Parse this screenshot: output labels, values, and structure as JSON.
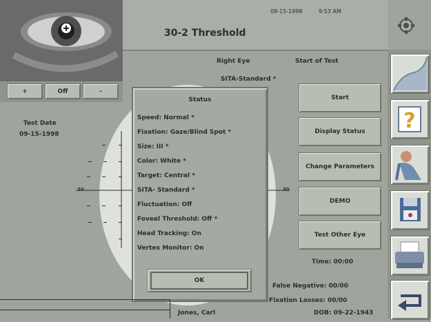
{
  "header": {
    "title": "30-2 Threshold",
    "date": "09-15-1998",
    "time": "9:53 AM"
  },
  "eye_camera": {
    "buttons": [
      "+",
      "Off",
      "-"
    ]
  },
  "test_info": {
    "eye": "Right Eye",
    "state": "Start of Test",
    "strategy": "SITA-Standard  *",
    "date_label": "Test Date",
    "date_value": "09-15-1998"
  },
  "status_dialog": {
    "title": "Status",
    "lines": [
      "Speed: Normal  *",
      "Fixation: Gaze/Blind Spot *",
      "Size: III  *",
      "Color: White  *",
      "Target: Central  *",
      "SITA- Standard  *",
      "Fluctuation: Off",
      "Foveal Threshold: Off  *",
      "Head Tracking: On",
      "Vertex Monitor: On"
    ],
    "ok": "OK"
  },
  "actions": [
    "Start",
    "Display Status",
    "Change Parameters",
    "DEMO",
    "Test Other Eye"
  ],
  "stats": {
    "timer": "Time: 00:00",
    "false_negative": "False Negative: 00/00",
    "fixation_losses": "Fixation Losses: 00/00",
    "patient": "Jones, Carl",
    "dob": "DOB: 09-22-1943"
  },
  "grid_labels": {
    "left": "30",
    "right": "30"
  },
  "colors": {
    "background": "#9fa59c",
    "field": "#dfe2dc",
    "panel": "#a4aaa1"
  },
  "sidebar_icons": [
    "visual-field-map-icon",
    "help-icon",
    "patient-icon",
    "floppy-disk-icon",
    "printer-icon",
    "return-arrow-icon"
  ]
}
